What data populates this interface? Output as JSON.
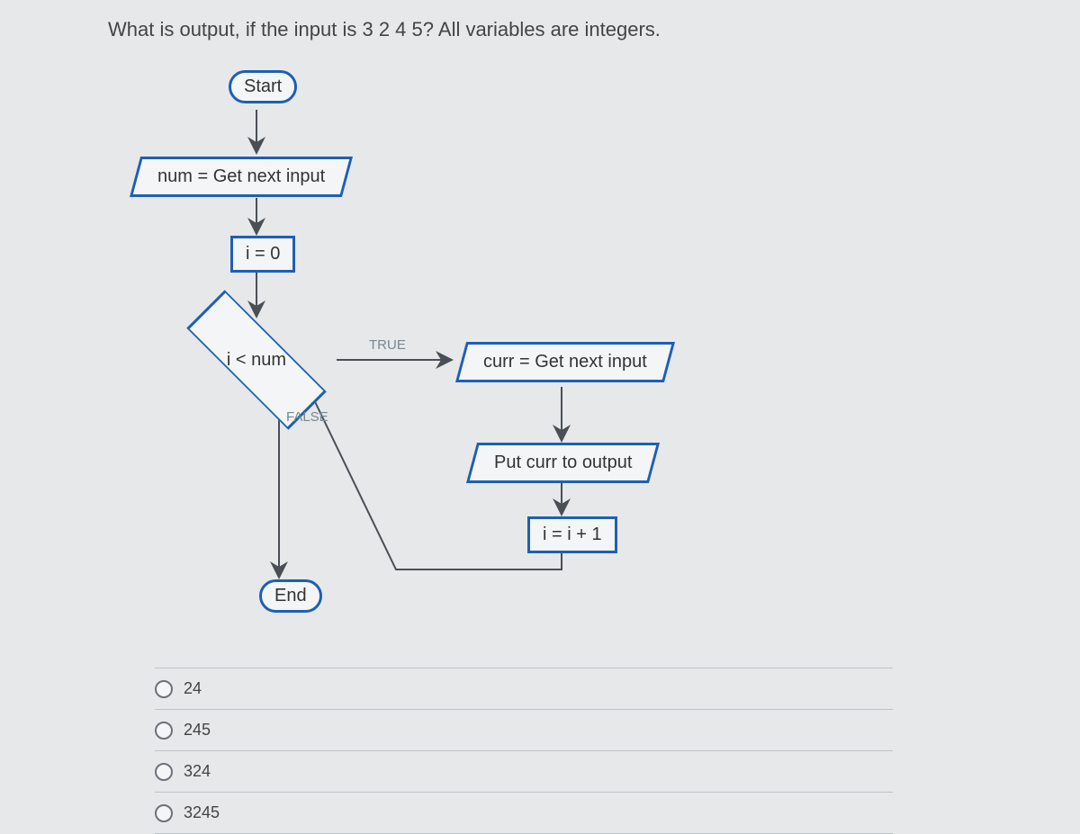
{
  "question": "What is output, if the input is 3 2 4 5? All variables are integers.",
  "flow": {
    "start": "Start",
    "numInput": "num = Get next input",
    "iZero": "i = 0",
    "decision": "i < num",
    "trueLabel": "TRUE",
    "falseLabel": "FALSE",
    "currInput": "curr = Get next input",
    "outputCurr": "Put curr to output",
    "increment": "i = i + 1",
    "end": "End"
  },
  "options": [
    "24",
    "245",
    "324",
    "3245"
  ],
  "chart_data": {
    "type": "flowchart",
    "nodes": [
      {
        "id": "start",
        "shape": "terminator",
        "label": "Start"
      },
      {
        "id": "numInput",
        "shape": "parallelogram",
        "label": "num = Get next input"
      },
      {
        "id": "iZero",
        "shape": "process",
        "label": "i = 0"
      },
      {
        "id": "decision",
        "shape": "decision",
        "label": "i < num"
      },
      {
        "id": "currInput",
        "shape": "parallelogram",
        "label": "curr = Get next input"
      },
      {
        "id": "outputCurr",
        "shape": "parallelogram",
        "label": "Put curr to output"
      },
      {
        "id": "increment",
        "shape": "process",
        "label": "i = i + 1"
      },
      {
        "id": "end",
        "shape": "terminator",
        "label": "End"
      }
    ],
    "edges": [
      {
        "from": "start",
        "to": "numInput"
      },
      {
        "from": "numInput",
        "to": "iZero"
      },
      {
        "from": "iZero",
        "to": "decision"
      },
      {
        "from": "decision",
        "to": "currInput",
        "label": "TRUE"
      },
      {
        "from": "currInput",
        "to": "outputCurr"
      },
      {
        "from": "outputCurr",
        "to": "increment"
      },
      {
        "from": "increment",
        "to": "decision"
      },
      {
        "from": "decision",
        "to": "end",
        "label": "FALSE"
      }
    ]
  }
}
